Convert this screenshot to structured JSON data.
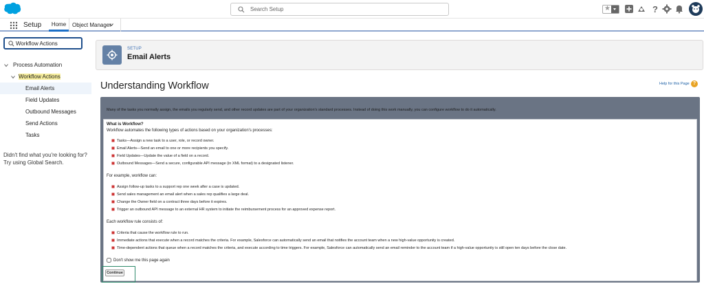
{
  "header": {
    "search_placeholder": "Search Setup",
    "icons": [
      "salesforce-logo-icon",
      "star-icon",
      "add-icon",
      "trailhead-icon",
      "help-icon",
      "gear-icon",
      "bell-icon",
      "avatar-icon"
    ],
    "brand_color": "#00a1e0"
  },
  "nav": {
    "app_title": "Setup",
    "tabs": [
      {
        "label": "Home"
      },
      {
        "label": "Object Manager"
      }
    ]
  },
  "sidebar": {
    "quickfind_value": "Workflow Actions",
    "tree": [
      {
        "label": "Process Automation"
      },
      {
        "label": "Workflow Actions"
      },
      {
        "label": "Email Alerts"
      },
      {
        "label": "Field Updates"
      },
      {
        "label": "Outbound Messages"
      },
      {
        "label": "Send Actions"
      },
      {
        "label": "Tasks"
      }
    ],
    "no_match": "Didn't find what you're looking for? Try using Global Search."
  },
  "page_header": {
    "crumb": "SETUP",
    "title": "Email Alerts"
  },
  "content": {
    "heading": "Understanding Workflow",
    "help_link": "Help for this Page",
    "banner": "Many of the tasks you normally assign, the emails you regularly send, and other record updates are part of your organization's standard processes. Instead of doing this work manually, you can configure workflow to do it automatically.",
    "what_title": "What is Workflow?",
    "what_text": "Workflow automates the following types of actions based on your organization's processes:",
    "types": [
      "Tasks—Assign a new task to a user, role, or record owner.",
      "Email Alerts—Send an email to one or more recipients you specify.",
      "Field Updates—Update the value of a field on a record.",
      "Outbound Messages—Send a secure, configurable API message (in XML format) to a designated listener."
    ],
    "example_title": "For example, workflow can:",
    "examples": [
      "Assign follow-up tasks to a support rep one week after a case is updated.",
      "Send sales management an email alert when a sales rep qualifies a large deal.",
      "Change the Owner field on a contract three days before it expires.",
      "Trigger an outbound API message to an external HR system to initiate the reimbursement process for an approved expense report."
    ],
    "rule_title": "Each workflow rule consists of:",
    "rules": [
      "Criteria that cause the workflow rule to run.",
      "Immediate actions that execute when a record matches the criteria. For example, Salesforce can automatically send an email that notifies the account team when a new high-value opportunity is created.",
      "Time-dependent actions that queue when a record matches the criteria, and execute according to time triggers. For example, Salesforce can automatically send an email reminder to the account team if a high-value opportunity is still open ten days before the close date."
    ],
    "dont_show": "Don't show me this page again",
    "continue_label": "Continue"
  }
}
